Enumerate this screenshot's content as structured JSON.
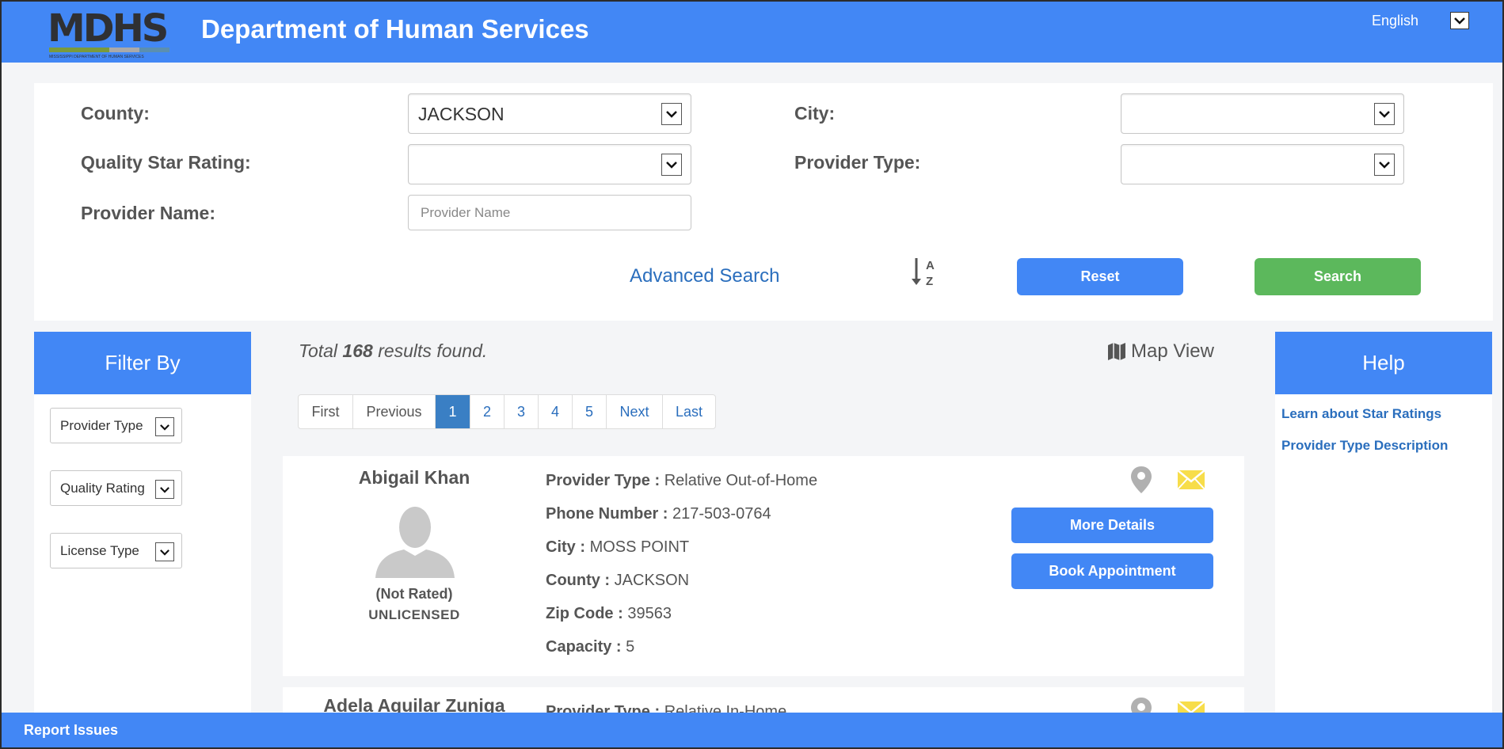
{
  "header": {
    "logo_text": "MDHS",
    "logo_subtext": "MISSISSIPPI DEPARTMENT OF HUMAN SERVICES",
    "logo_colors": [
      "#7a9a3c",
      "#7a9a3c",
      "#a9a9a9",
      "#5b8fb0"
    ],
    "title": "Department of Human Services",
    "language": "English"
  },
  "search": {
    "county_label": "County:",
    "county_value": "JACKSON",
    "city_label": "City:",
    "city_value": "",
    "quality_label": "Quality Star Rating:",
    "quality_value": "",
    "provider_type_label": "Provider Type:",
    "provider_type_value": "",
    "provider_name_label": "Provider Name:",
    "provider_name_placeholder": "Provider Name",
    "advanced_search": "Advanced Search",
    "sort_icon": "sort-alpha-down-icon",
    "reset": "Reset",
    "search": "Search"
  },
  "filter": {
    "title": "Filter By",
    "items": [
      "Provider Type",
      "Quality Rating",
      "License Type"
    ]
  },
  "results": {
    "total_prefix": "Total",
    "total_count": "168",
    "total_suffix": "results found.",
    "map_view": "Map View"
  },
  "pagination": [
    "First",
    "Previous",
    "1",
    "2",
    "3",
    "4",
    "5",
    "Next",
    "Last"
  ],
  "pagination_active": "1",
  "providers": [
    {
      "name": "Abigail Khan",
      "rating": "(Not Rated)",
      "license": "UNLICENSED",
      "fields": [
        {
          "label": "Provider Type :",
          "value": "Relative Out-of-Home"
        },
        {
          "label": "Phone Number :",
          "value": "217-503-0764"
        },
        {
          "label": "City :",
          "value": "MOSS POINT"
        },
        {
          "label": "County :",
          "value": "JACKSON"
        },
        {
          "label": "Zip Code :",
          "value": "39563"
        },
        {
          "label": "Capacity :",
          "value": "5"
        }
      ],
      "more_details": "More Details",
      "book": "Book Appointment"
    },
    {
      "name": "Adela Aguilar Zuniga",
      "fields": [
        {
          "label": "Provider Type :",
          "value": "Relative In-Home"
        }
      ]
    }
  ],
  "help": {
    "title": "Help",
    "links": [
      "Learn about Star Ratings",
      "Provider Type Description"
    ]
  },
  "footer": {
    "report_issues": "Report Issues"
  },
  "colors": {
    "primary": "#4287f5",
    "search_green": "#5cb85c",
    "link": "#2a6ebd",
    "mail_yellow": "#f7dd4a",
    "pin_gray": "#b0b0b0"
  }
}
